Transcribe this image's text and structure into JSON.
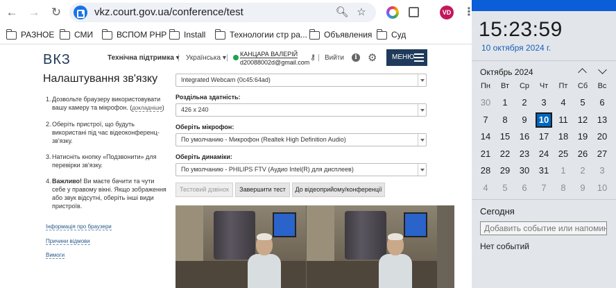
{
  "browser": {
    "url": "vkz.court.gov.ua/conference/test",
    "avatar_initials": "VD",
    "bookmarks": [
      "РАЗНОЕ",
      "СМИ",
      "ВСПОМ PHP",
      "Install",
      "Технологии стр ра...",
      "Объявления",
      "Суд"
    ]
  },
  "site": {
    "logo": "ВКЗ",
    "nav": {
      "support": "Технічна підтримка ▾",
      "language": "Українська ▾",
      "user_name": "КАНЦАРА ВАЛЕРІЙ",
      "user_email": "d20088002d@gmail.com",
      "logout": "Вийти",
      "menu": "МЕНЮ"
    },
    "title": "Налаштування зв'язку",
    "steps": [
      {
        "n": "1.",
        "text": "Дозвольте браузеру використовувати вашу камеру та мікрофон. (",
        "link": "докладніше",
        "tail": ")"
      },
      {
        "n": "2.",
        "text": "Оберіть пристрої, що будуть використані під час відеоконференц-зв'язку."
      },
      {
        "n": "3.",
        "text": "Натисніть кнопку «Подзвонити» для перевірки зв'язку."
      },
      {
        "n": "4.",
        "bold": "Важливо!",
        "text": " Ви маєте бачити та чути себе у правому вікні. Якщо зображення або звук відсутні, оберіть інші види пристроїв."
      }
    ],
    "side_links": [
      "Інформація про браузери",
      "Причини відмови",
      "Вимоги"
    ],
    "camera_select": "Integrated Webcam (0c45:64ad)",
    "resolution_label": "Роздільна здатність:",
    "resolution_value": "426 x 240",
    "mic_label": "Оберіть мікрофон:",
    "mic_value": "По умолчанию - Микрофон (Realtek High Definition Audio)",
    "speaker_label": "Оберіть динаміки:",
    "speaker_value": "По умолчанию - PHILIPS FTV (Аудио Intel(R) для дисплеев)",
    "buttons": {
      "test_call": "Тестовий дзвінок",
      "end_test": "Завершити тест",
      "to_reception": "До відеоприйому/конференції"
    }
  },
  "flyout": {
    "time": "15:23:59",
    "date": "10 октября 2024 г.",
    "month": "Октябрь 2024",
    "weekdays": [
      "Пн",
      "Вт",
      "Ср",
      "Чт",
      "Пт",
      "Сб",
      "Вс"
    ],
    "weeks": [
      [
        {
          "d": "30",
          "m": true
        },
        {
          "d": "1"
        },
        {
          "d": "2"
        },
        {
          "d": "3"
        },
        {
          "d": "4"
        },
        {
          "d": "5"
        },
        {
          "d": "6"
        }
      ],
      [
        {
          "d": "7"
        },
        {
          "d": "8"
        },
        {
          "d": "9"
        },
        {
          "d": "10",
          "t": true
        },
        {
          "d": "11"
        },
        {
          "d": "12"
        },
        {
          "d": "13"
        }
      ],
      [
        {
          "d": "14"
        },
        {
          "d": "15"
        },
        {
          "d": "16"
        },
        {
          "d": "17"
        },
        {
          "d": "18"
        },
        {
          "d": "19"
        },
        {
          "d": "20"
        }
      ],
      [
        {
          "d": "21"
        },
        {
          "d": "22"
        },
        {
          "d": "23"
        },
        {
          "d": "24"
        },
        {
          "d": "25"
        },
        {
          "d": "26"
        },
        {
          "d": "27"
        }
      ],
      [
        {
          "d": "28"
        },
        {
          "d": "29"
        },
        {
          "d": "30"
        },
        {
          "d": "31"
        },
        {
          "d": "1",
          "m": true
        },
        {
          "d": "2",
          "m": true
        },
        {
          "d": "3",
          "m": true
        }
      ],
      [
        {
          "d": "4",
          "m": true
        },
        {
          "d": "5",
          "m": true
        },
        {
          "d": "6",
          "m": true
        },
        {
          "d": "7",
          "m": true
        },
        {
          "d": "8",
          "m": true
        },
        {
          "d": "9",
          "m": true
        },
        {
          "d": "10",
          "m": true
        }
      ]
    ],
    "today_label": "Сегодня",
    "add_event_placeholder": "Добавить событие или напомина",
    "no_events": "Нет событий"
  }
}
